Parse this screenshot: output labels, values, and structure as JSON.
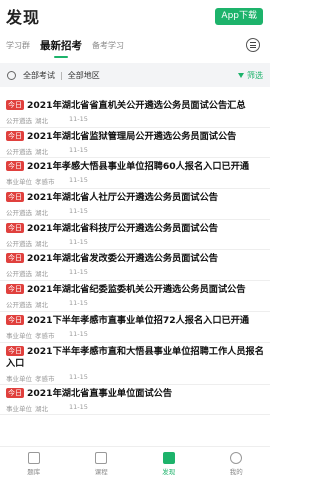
{
  "header": {
    "title": "发现",
    "app_button": "App下载"
  },
  "tabs": [
    {
      "label": "学习群",
      "active": false
    },
    {
      "label": "最新招考",
      "active": true
    },
    {
      "label": "备考学习",
      "active": false
    }
  ],
  "filter": {
    "exam": "全部考试",
    "separator": "|",
    "region": "全部地区",
    "filter_label": "筛选"
  },
  "news": [
    {
      "badge": "今日",
      "title": "2021年湖北省省直机关公开遴选公务员面试公告汇总",
      "type": "公开遴选",
      "region": "湖北",
      "date": "11-15"
    },
    {
      "badge": "今日",
      "title": "2021年湖北省监狱管理局公开遴选公务员面试公告",
      "type": "公开遴选",
      "region": "湖北",
      "date": "11-15"
    },
    {
      "badge": "今日",
      "title": "2021年孝感大悟县事业单位招聘60人报名入口已开通",
      "type": "事业单位",
      "region": "孝感市",
      "date": "11-15"
    },
    {
      "badge": "今日",
      "title": "2021年湖北省人社厅公开遴选公务员面试公告",
      "type": "公开遴选",
      "region": "湖北",
      "date": "11-15"
    },
    {
      "badge": "今日",
      "title": "2021年湖北省科技厅公开遴选公务员面试公告",
      "type": "公开遴选",
      "region": "湖北",
      "date": "11-15"
    },
    {
      "badge": "今日",
      "title": "2021年湖北省发改委公开遴选公务员面试公告",
      "type": "公开遴选",
      "region": "湖北",
      "date": "11-15"
    },
    {
      "badge": "今日",
      "title": "2021年湖北省纪委监委机关公开遴选公务员面试公告",
      "type": "公开遴选",
      "region": "湖北",
      "date": "11-15"
    },
    {
      "badge": "今日",
      "title": "2021下半年孝感市直事业单位招72人报名入口已开通",
      "type": "事业单位",
      "region": "孝感市",
      "date": "11-15"
    },
    {
      "badge": "今日",
      "title": "2021下半年孝感市直和大悟县事业单位招聘工作人员报名入口",
      "type": "事业单位",
      "region": "孝感市",
      "date": "11-15"
    },
    {
      "badge": "今日",
      "title": "2021年湖北省直事业单位面试公告",
      "type": "事业单位",
      "region": "湖北",
      "date": "11-15"
    }
  ],
  "bottom_nav": [
    {
      "label": "题库",
      "icon": "book-icon",
      "active": false
    },
    {
      "label": "课程",
      "icon": "course-icon",
      "active": false
    },
    {
      "label": "发现",
      "icon": "discover-icon",
      "active": true
    },
    {
      "label": "我的",
      "icon": "user-icon",
      "active": false
    }
  ]
}
